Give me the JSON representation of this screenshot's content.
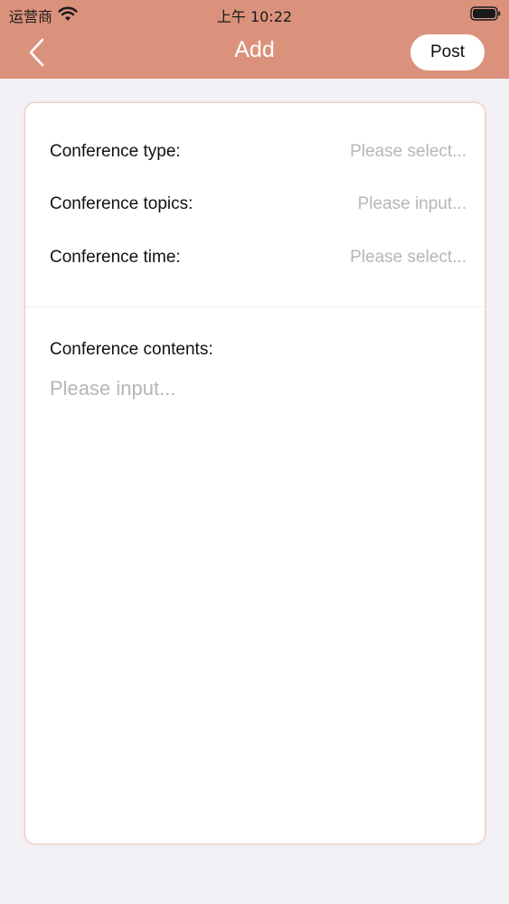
{
  "status_bar": {
    "carrier": "运营商",
    "time": "上午 10:22"
  },
  "nav": {
    "title": "Add",
    "back_icon": "chevron-left-icon",
    "post_label": "Post"
  },
  "form": {
    "rows": [
      {
        "label": "Conference type:",
        "placeholder": "Please select..."
      },
      {
        "label": "Conference topics:",
        "placeholder": "Please input..."
      },
      {
        "label": "Conference time:",
        "placeholder": "Please select..."
      }
    ],
    "contents_label": "Conference contents:",
    "contents_placeholder": "Please input..."
  },
  "colors": {
    "header": "#db927c",
    "background": "#f2f1f6",
    "card_border": "#efc9c2",
    "placeholder": "#b6b6bb"
  }
}
